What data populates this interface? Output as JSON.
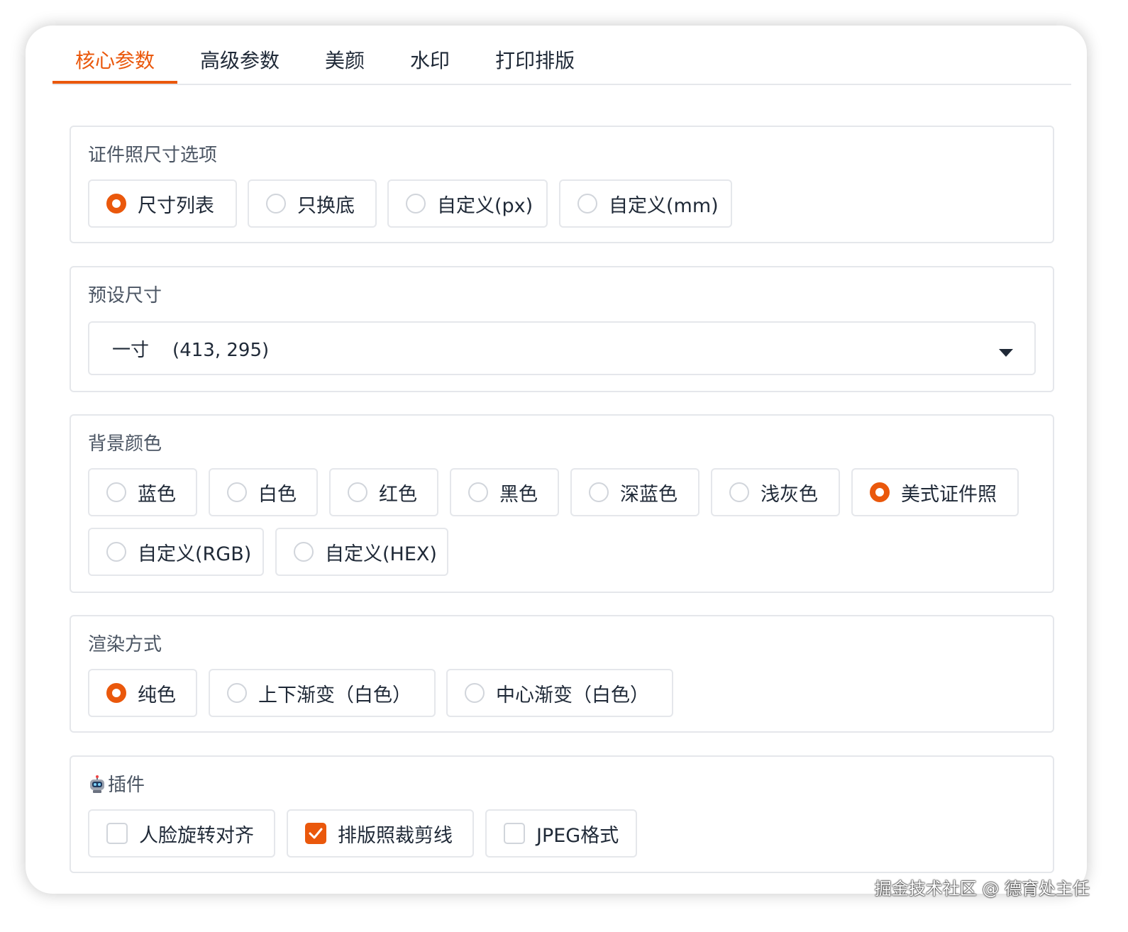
{
  "tabs": [
    {
      "label": "核心参数",
      "active": true
    },
    {
      "label": "高级参数"
    },
    {
      "label": "美颜"
    },
    {
      "label": "水印"
    },
    {
      "label": "打印排版"
    }
  ],
  "size_options": {
    "title": "证件照尺寸选项",
    "options": [
      "尺寸列表",
      "只换底",
      "自定义(px)",
      "自定义(mm)"
    ],
    "selected": "尺寸列表"
  },
  "preset_size": {
    "title": "预设尺寸",
    "value": "一寸    (413, 295)"
  },
  "bg_color": {
    "title": "背景颜色",
    "options": [
      "蓝色",
      "白色",
      "红色",
      "黑色",
      "深蓝色",
      "浅灰色",
      "美式证件照",
      "自定义(RGB)",
      "自定义(HEX)"
    ],
    "selected": "美式证件照"
  },
  "render_mode": {
    "title": "渲染方式",
    "options": [
      "纯色",
      "上下渐变（白色）",
      "中心渐变（白色）"
    ],
    "selected": "纯色"
  },
  "plugins": {
    "title": "插件",
    "icon": "robot-icon",
    "options": [
      {
        "label": "人脸旋转对齐",
        "checked": false
      },
      {
        "label": "排版照裁剪线",
        "checked": true
      },
      {
        "label": "JPEG格式",
        "checked": false
      }
    ]
  },
  "watermark": "掘金技术社区 @ 德育处主任",
  "colors": {
    "accent": "#ea580c",
    "border": "#e5e7eb"
  }
}
